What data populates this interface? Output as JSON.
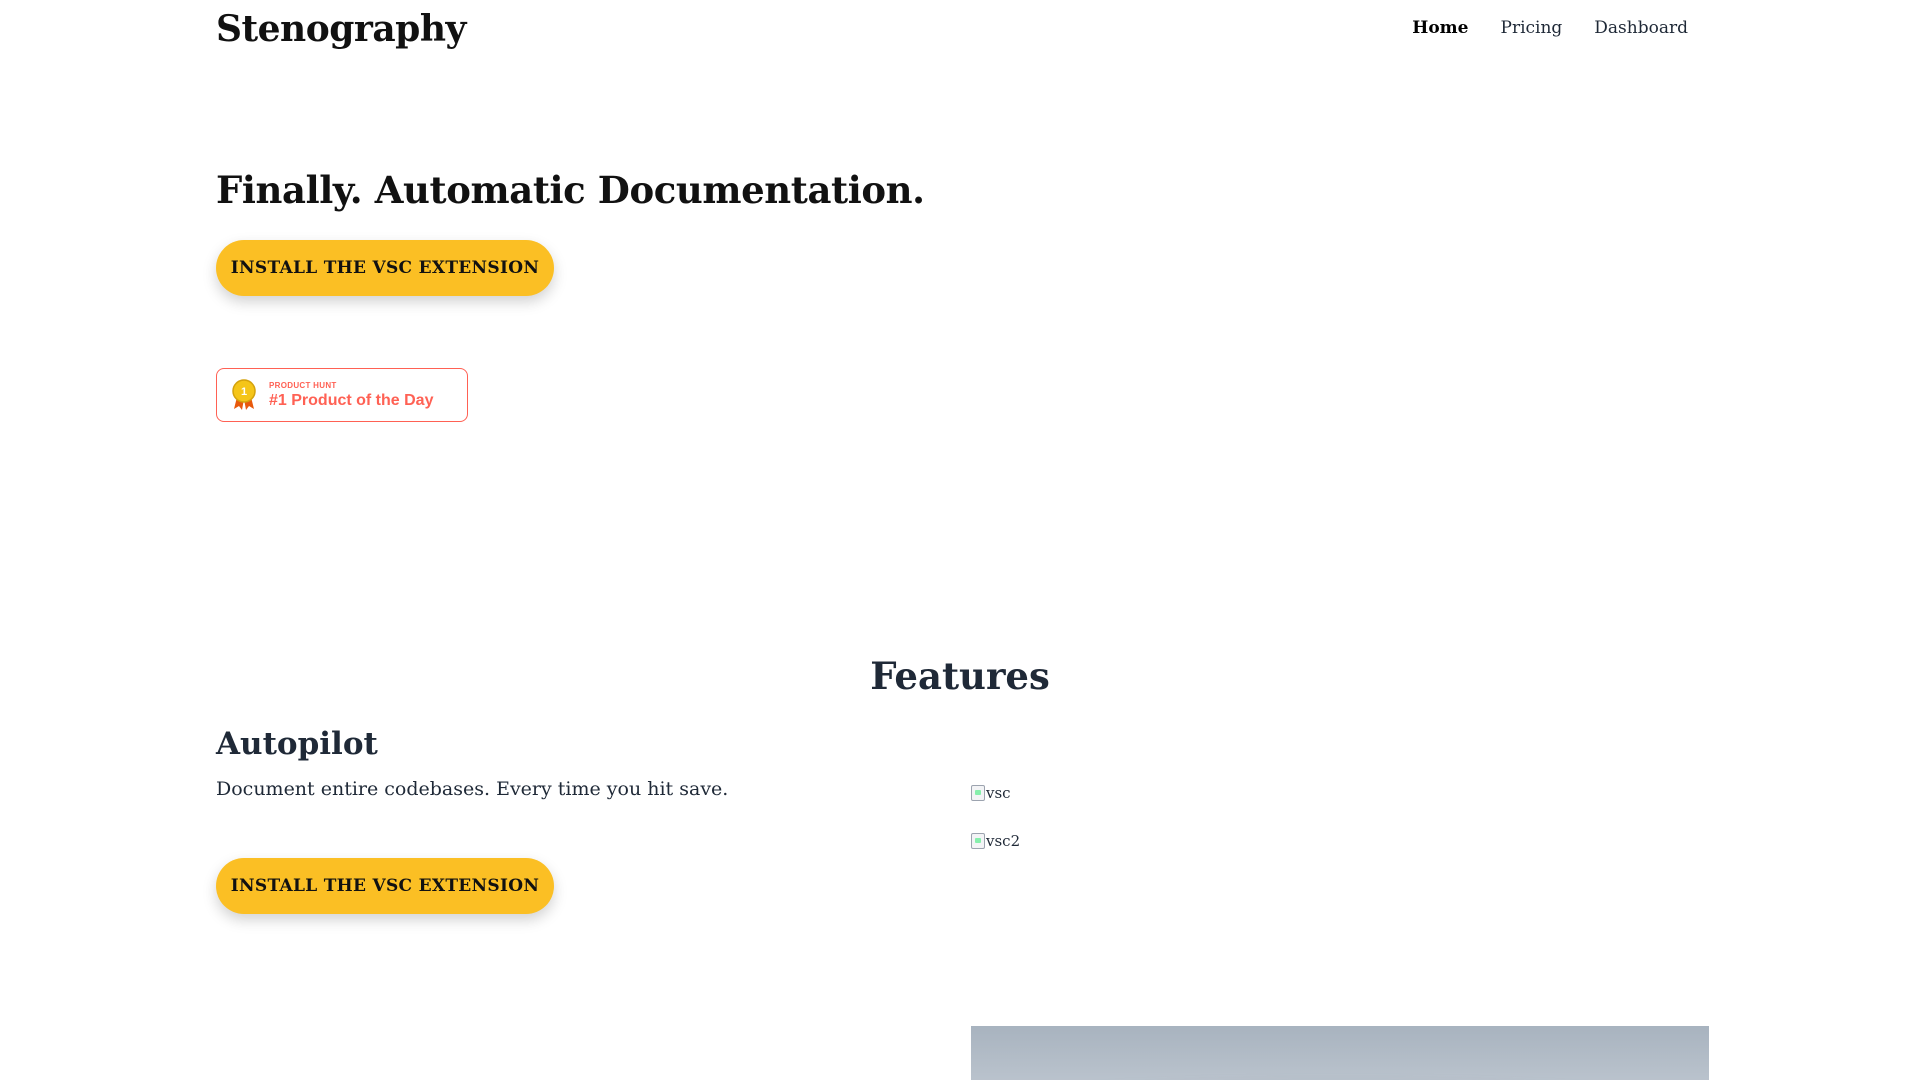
{
  "header": {
    "brand": "Stenography",
    "nav": [
      {
        "label": "Home",
        "active": true
      },
      {
        "label": "Pricing",
        "active": false
      },
      {
        "label": "Dashboard",
        "active": false
      }
    ]
  },
  "hero": {
    "title": "Finally. Automatic Documentation.",
    "cta_label": "INSTALL THE VSC EXTENSION"
  },
  "product_hunt_badge": {
    "kicker": "PRODUCT HUNT",
    "label": "#1 Product of the Day",
    "medal_number": "1",
    "icon": "medal-icon",
    "color": "#ff6154"
  },
  "features": {
    "title": "Features",
    "items": [
      {
        "heading": "Autopilot",
        "description": "Document entire codebases. Every time you hit save.",
        "cta_label": "INSTALL THE VSC EXTENSION",
        "images": [
          {
            "alt": "vsc"
          },
          {
            "alt": "vsc2"
          }
        ]
      }
    ]
  },
  "colors": {
    "accent": "#fbbf24",
    "text": "#1f2937",
    "badge": "#ff6154",
    "preview": "#a8b3bf"
  }
}
